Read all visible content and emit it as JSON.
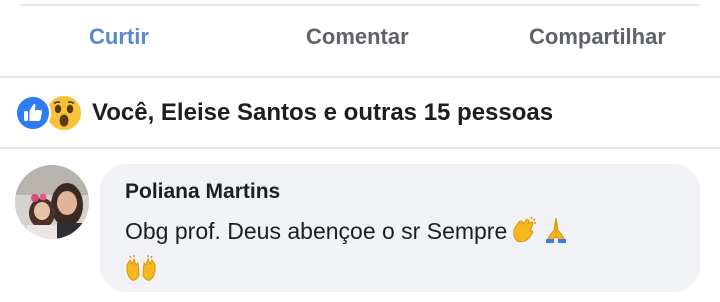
{
  "actions": {
    "like_label": "Curtir",
    "comment_label": "Comentar",
    "share_label": "Compartilhar",
    "like_color": "#5b88c9"
  },
  "reactions": {
    "icons": [
      "thumbs-up-icon",
      "wow-face-icon"
    ],
    "summary": "Você, Eleise Santos e outras 15 pessoas"
  },
  "comment": {
    "author": "Poliana Martins",
    "text": "Obg prof. Deus abençoe o sr Sempre",
    "emojis": [
      "clapping-hands-emoji",
      "folded-hands-emoji",
      "raising-hands-emoji"
    ]
  }
}
